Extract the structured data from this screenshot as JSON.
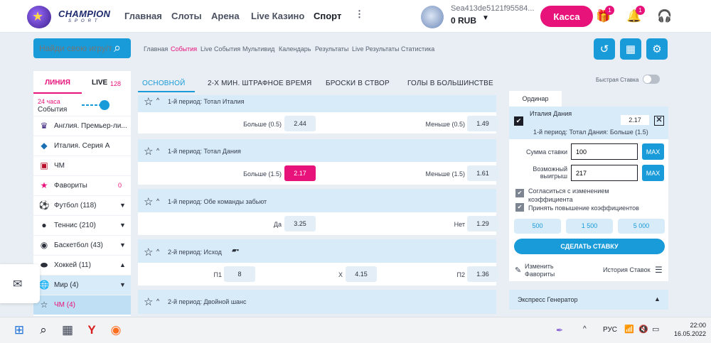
{
  "header": {
    "brand": "CHAMPION",
    "brand_sub": "SPORT",
    "nav": [
      "Главная",
      "Слоты",
      "Арена",
      "Live Казино",
      "Спорт"
    ],
    "nav_active_index": 4,
    "account_id": "Sea413de5121f95584...",
    "balance": "0 RUB",
    "cash_button": "Касса",
    "gift_badge": "1",
    "bell_badge": "1"
  },
  "search": {
    "placeholder": "Найди свою игру/т"
  },
  "breadcrumbs": [
    "Главная",
    "События",
    "Live События",
    "Мультивид",
    "Календарь",
    "Результаты",
    "Live Результаты",
    "Статистика"
  ],
  "sidebar": {
    "tab_line": "ЛИНИЯ",
    "tab_live": "LIVE",
    "live_count": "128",
    "range_hours": "24 часа",
    "range_label": "События",
    "items": [
      {
        "label": "Англия. Премьер-ли...",
        "icon": "premier-league-icon"
      },
      {
        "label": "Италия. Серия А",
        "icon": "serie-a-icon"
      },
      {
        "label": "ЧМ",
        "icon": "world-cup-icon"
      },
      {
        "label": "Фавориты",
        "count": "0",
        "icon": "star-icon"
      },
      {
        "label": "Футбол (118)",
        "icon": "football-icon"
      },
      {
        "label": "Теннис (210)",
        "icon": "tennis-icon"
      },
      {
        "label": "Баскетбол (43)",
        "icon": "basketball-icon"
      },
      {
        "label": "Хоккей (11)",
        "icon": "hockey-icon"
      },
      {
        "label": "Мир (4)",
        "icon": "globe-icon"
      },
      {
        "label": "ЧМ (4)",
        "icon": "star-outline-icon"
      }
    ]
  },
  "main": {
    "tabs": [
      "ОСНОВНОЙ",
      "2-Х МИН. ШТРАФНОЕ ВРЕМЯ",
      "БРОСКИ В СТВОР",
      "ГОЛЫ В БОЛЬШИНСТВЕ"
    ],
    "markets": [
      {
        "title": "1-й период: Тотал Италия",
        "outcomes": [
          {
            "label": "Больше (0.5)",
            "odd": "2.44"
          },
          {
            "label": "Меньше (0.5)",
            "odd": "1.49"
          }
        ]
      },
      {
        "title": "1-й период: Тотал Дания",
        "outcomes": [
          {
            "label": "Больше (1.5)",
            "odd": "2.17"
          },
          {
            "label": "Меньше (1.5)",
            "odd": "1.61"
          }
        ]
      },
      {
        "title": "1-й период: Обе команды забьют",
        "outcomes": [
          {
            "label": "Да",
            "odd": "3.25"
          },
          {
            "label": "Нет",
            "odd": "1.29"
          }
        ]
      },
      {
        "title": "2-й период: Исход",
        "outcomes": [
          {
            "label": "П1",
            "odd": "8"
          },
          {
            "label": "Х",
            "odd": "4.15"
          },
          {
            "label": "П2",
            "odd": "1.36"
          }
        ]
      },
      {
        "title": "2-й период: Двойной шанс",
        "outcomes": []
      }
    ]
  },
  "betslip": {
    "quick_bet": "Быстрая Ставка",
    "tab": "Ординар",
    "selection": "Италия Дания",
    "selection_odd": "2.17",
    "selection_market": "1-й период: Тотал Дания: Больше (1.5)",
    "stake_label": "Сумма ставки",
    "stake_value": "100",
    "win_label_1": "Возможный",
    "win_label_2": "выигрыш",
    "win_value": "217",
    "max": "MAX",
    "agree_1": "Согласиться с изменением",
    "agree_2": "коэффициента",
    "accept_raise": "Принять повышение коэффициентов",
    "quick_amounts": [
      "500",
      "1 500",
      "5 000"
    ],
    "place": "СДЕЛАТЬ СТАВКУ",
    "fav_1": "Изменить",
    "fav_2": "Фавориты",
    "history": "История Ставок",
    "express": "Экспресс Генератор"
  },
  "taskbar": {
    "lang": "РУС",
    "time": "22:00",
    "date": "16.05.2022"
  },
  "colors": {
    "accent": "#1a9bd9",
    "brand": "#e8127b"
  }
}
